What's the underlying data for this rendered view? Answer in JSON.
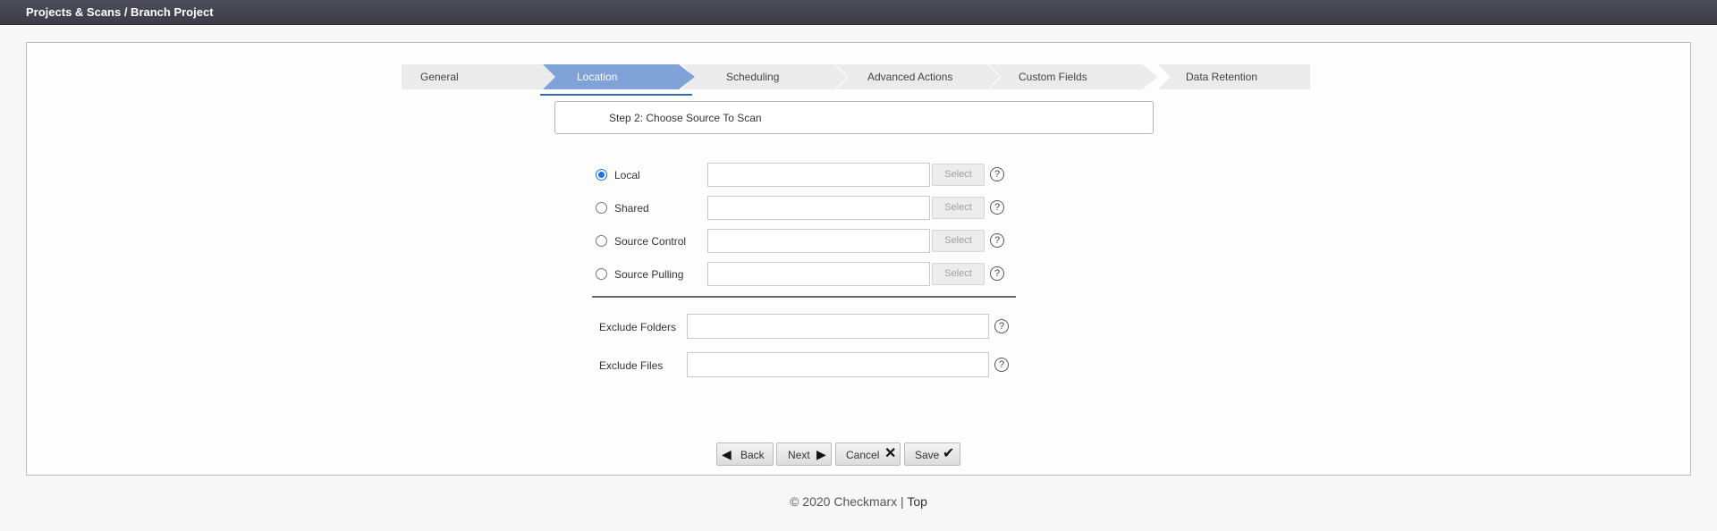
{
  "header": {
    "title": "Projects & Scans / Branch Project"
  },
  "wizard": {
    "steps": [
      {
        "label": "General"
      },
      {
        "label": "Location"
      },
      {
        "label": "Scheduling"
      },
      {
        "label": "Advanced Actions"
      },
      {
        "label": "Custom Fields"
      },
      {
        "label": "Data Retention"
      }
    ],
    "active_step": "Location",
    "step_title": "Step 2: Choose Source To Scan"
  },
  "sources": [
    {
      "label": "Local",
      "selected": true,
      "value": "",
      "button": "Select"
    },
    {
      "label": "Shared",
      "selected": false,
      "value": "",
      "button": "Select"
    },
    {
      "label": "Source Control",
      "selected": false,
      "value": "",
      "button": "Select"
    },
    {
      "label": "Source Pulling",
      "selected": false,
      "value": "",
      "button": "Select"
    }
  ],
  "excludes": [
    {
      "label": "Exclude Folders",
      "value": ""
    },
    {
      "label": "Exclude Files",
      "value": ""
    }
  ],
  "help_glyph": "?",
  "buttons": {
    "back": "Back",
    "next": "Next",
    "cancel": "Cancel",
    "save": "Save"
  },
  "icons": {
    "back": "play-left-icon",
    "next": "play-right-icon",
    "cancel": "x-icon",
    "save": "check-icon"
  },
  "footer": {
    "copyright": "© 2020 Checkmarx",
    "separator": "|",
    "top_link": "Top"
  },
  "colors": {
    "active_step": "#7fa3d6",
    "inactive_step": "#ebebeb",
    "accent": "#2f6db4"
  }
}
